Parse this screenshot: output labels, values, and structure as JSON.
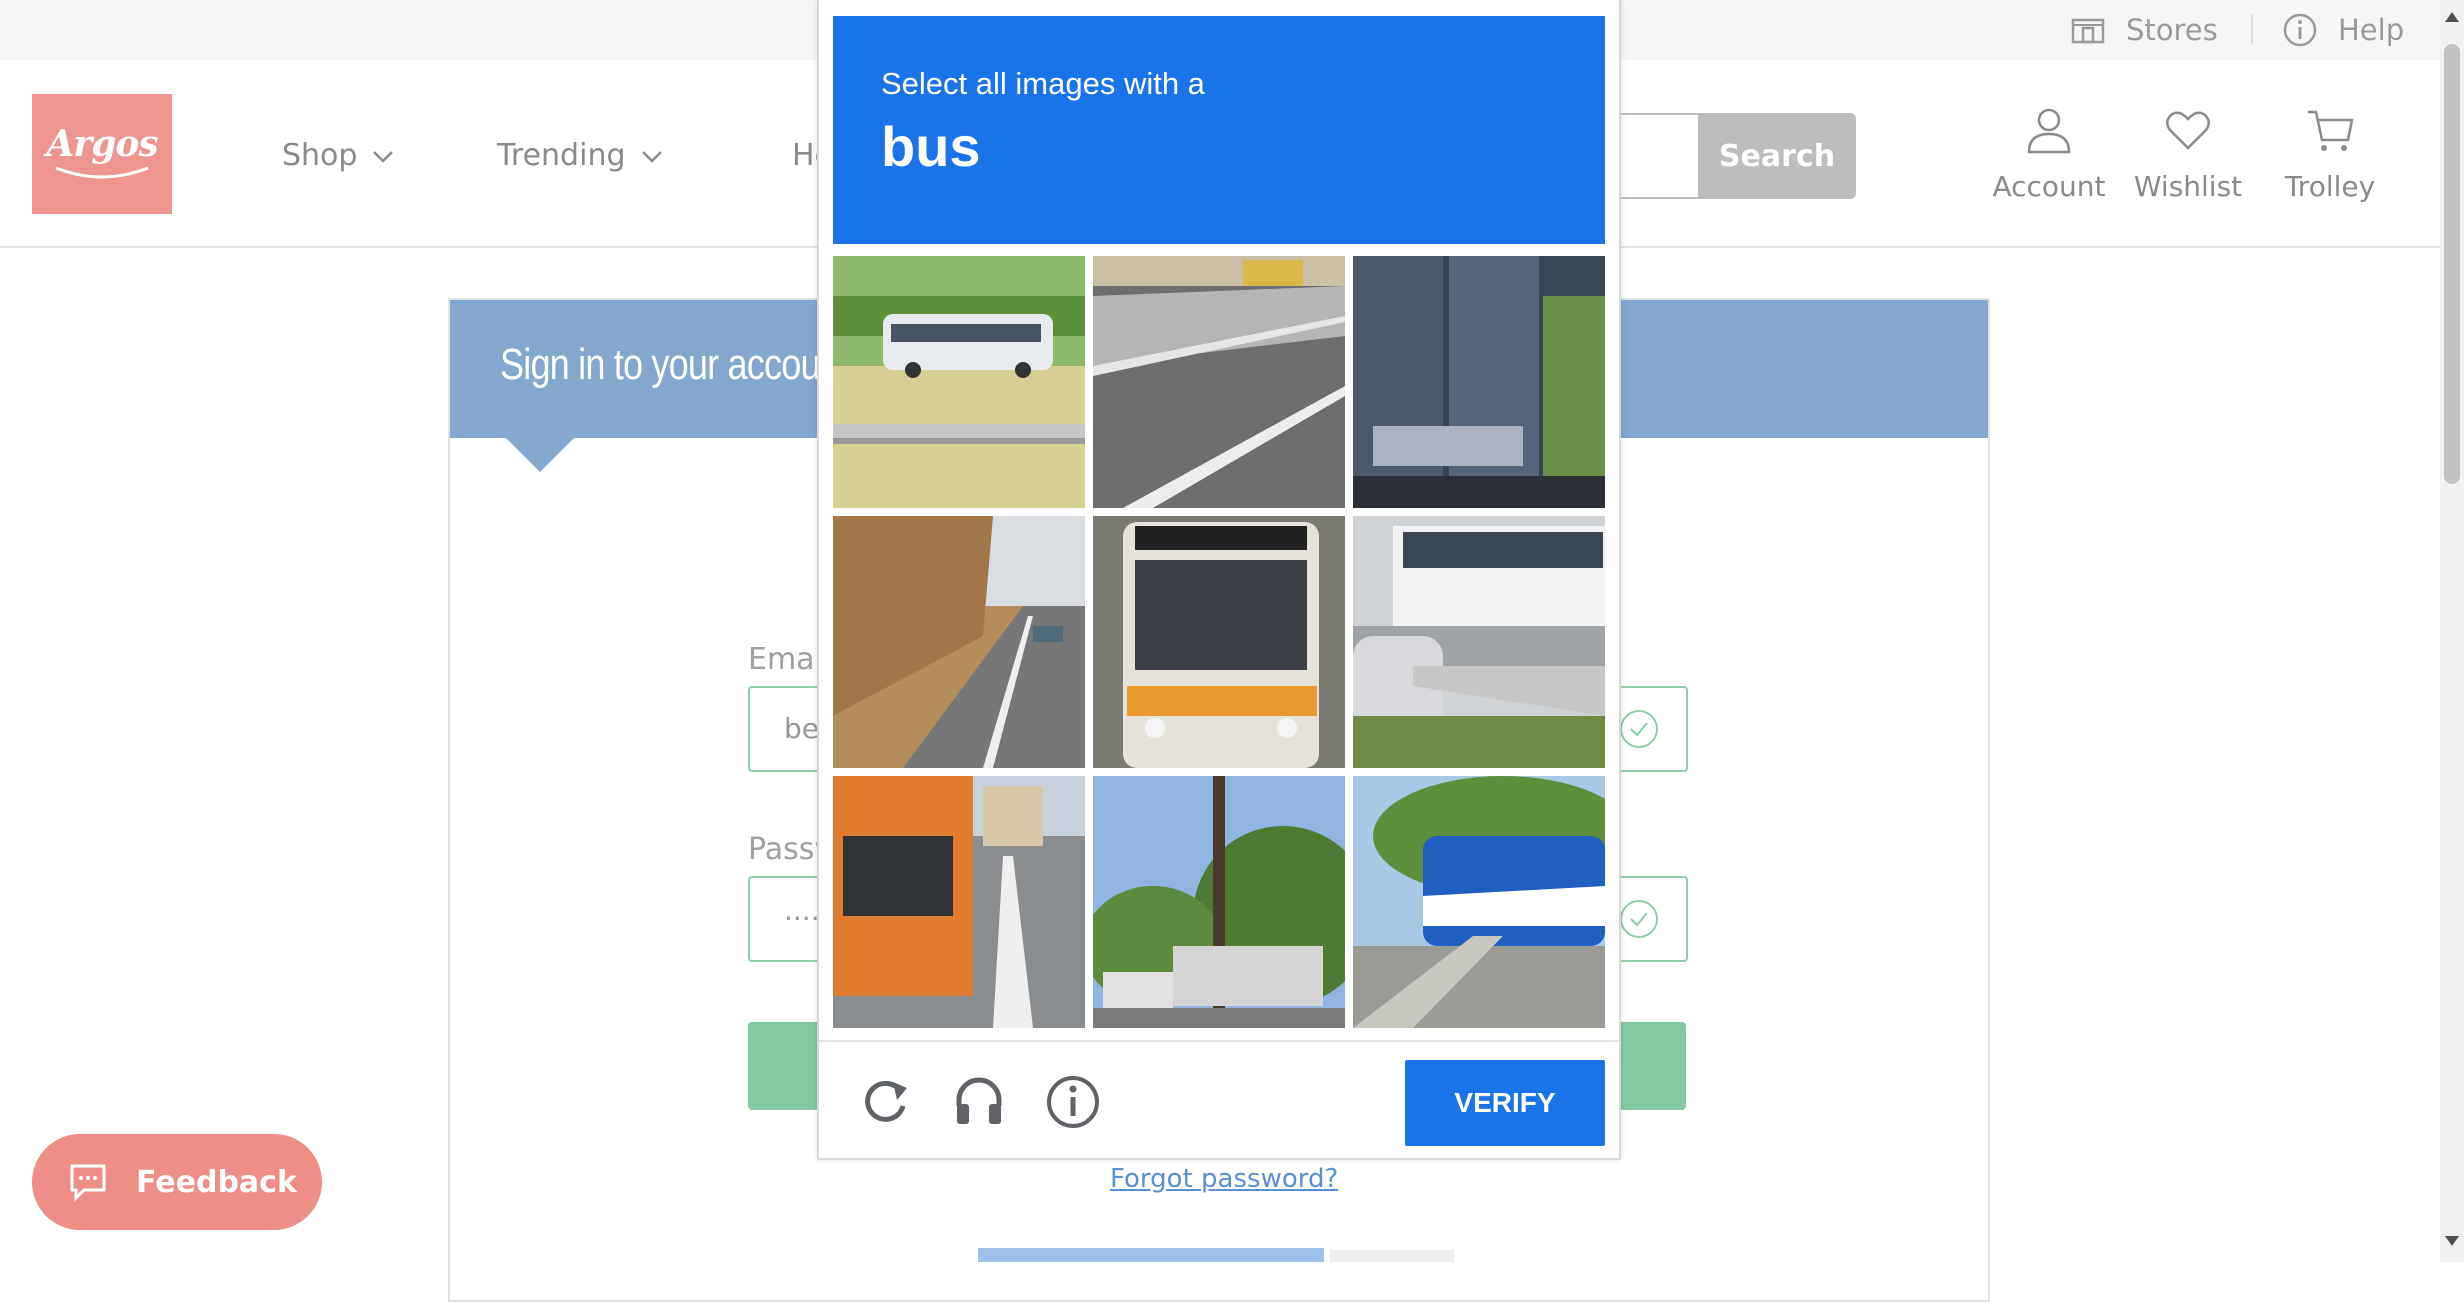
{
  "utility_bar": {
    "stores_label": "Stores",
    "help_label": "Help"
  },
  "header": {
    "logo_text": "Argos",
    "nav": [
      {
        "label": "Shop"
      },
      {
        "label": "Trending"
      },
      {
        "label": "He"
      }
    ],
    "search_button": "Search",
    "account_label": "Account",
    "wishlist_label": "Wishlist",
    "trolley_label": "Trolley"
  },
  "signin": {
    "title": "Sign in to your accou",
    "email_label": "Emai",
    "email_value": "ber",
    "password_label": "Passw",
    "password_value": "·····",
    "forgot_link": "Forgot password?"
  },
  "feedback_label": "Feedback",
  "captcha": {
    "prompt": "Select all images with a",
    "target": "bus",
    "verify_label": "VERIFY",
    "icons": [
      "reload-icon",
      "headphones-icon",
      "info-icon"
    ],
    "accent_color": "#1a73e8"
  },
  "colors": {
    "brand": "#ed9590",
    "panel_header": "#84a7cf",
    "success_border": "#8ccfa7"
  }
}
